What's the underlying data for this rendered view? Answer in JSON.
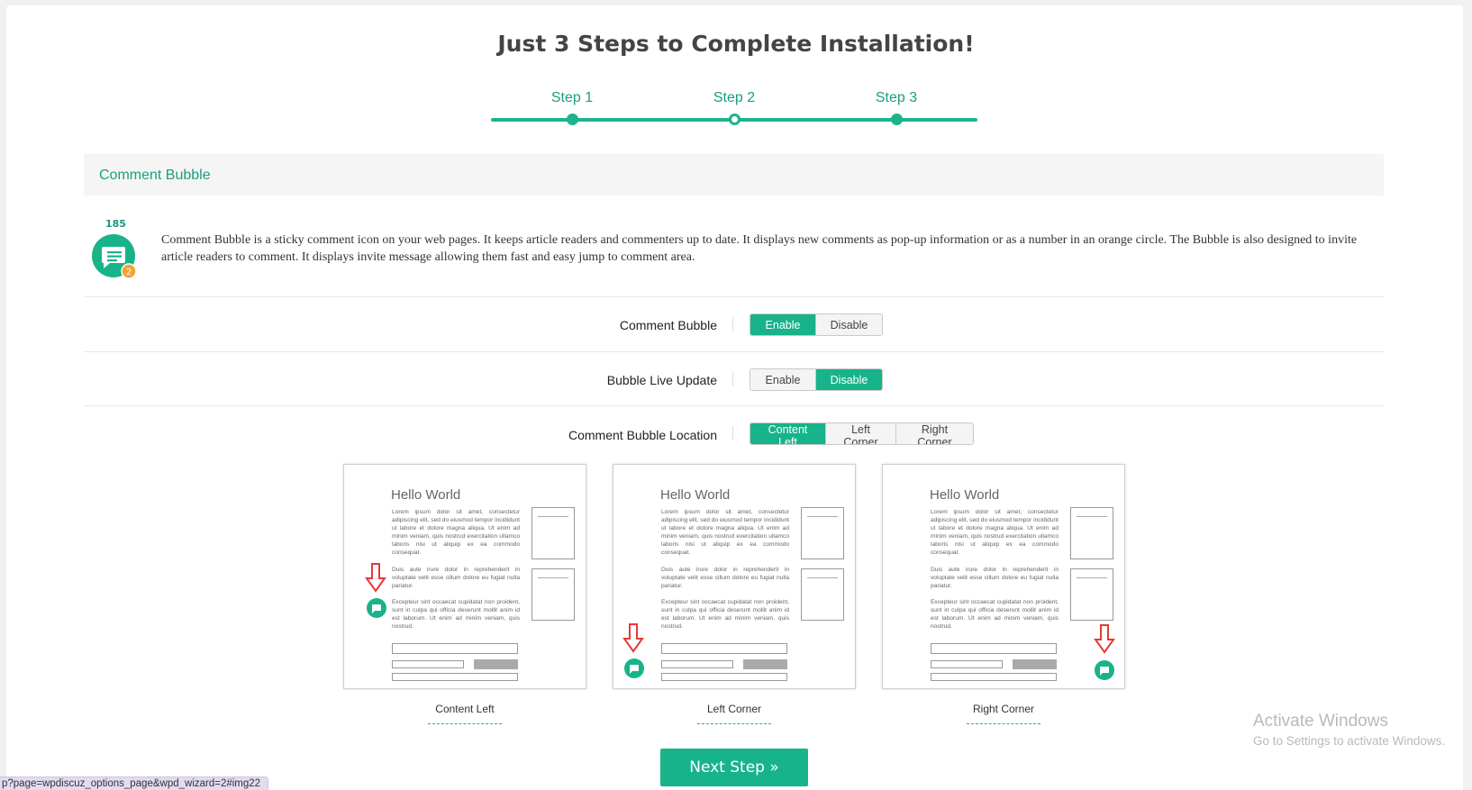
{
  "wizard": {
    "title": "Just 3 Steps to Complete Installation!",
    "steps": [
      {
        "label": "Step 1",
        "state": "done"
      },
      {
        "label": "Step 2",
        "state": "current"
      },
      {
        "label": "Step 3",
        "state": "pending"
      }
    ]
  },
  "section": {
    "heading": "Comment Bubble",
    "bubble_count": "185",
    "bubble_badge": "2",
    "description": "Comment Bubble is a sticky comment icon on your web pages. It keeps article readers and commenters up to date. It displays new comments as pop-up information or as a number in an orange circle. The Bubble is also designed to invite article readers to comment. It displays invite message allowing them fast and easy jump to comment area."
  },
  "options": {
    "comment_bubble": {
      "label": "Comment Bubble",
      "enable": "Enable",
      "disable": "Disable",
      "selected": "Enable"
    },
    "live_update": {
      "label": "Bubble Live Update",
      "enable": "Enable",
      "disable": "Disable",
      "selected": "Disable"
    },
    "location": {
      "label": "Comment Bubble Location",
      "content_left": "Content Left",
      "left_corner": "Left Corner",
      "right_corner": "Right Corner",
      "selected": "Content Left"
    }
  },
  "preview": {
    "title": "Hello World",
    "para1": "Lorem ipsum dolor sit amet, consectetur adipiscing elit, sed do eiusmod tempor incididunt ut labore et dolore magna aliqua. Ut enim ad minim veniam, quis nostrud exercitation ullamco laboris nisi ut aliquip ex ea commodo consequat.",
    "para2": "Duis aute irure dolor in reprehenderit in voluptate velit esse cillum dolore eu fugiat nulla pariatur.",
    "para3": "Excepteur sint occaecat cupidatat non proident, sunt in culpa qui officia deserunt mollit anim id est laborum. Ut enim ad minim veniam, quis nostrud.",
    "captions": {
      "content_left": "Content Left",
      "left_corner": "Left Corner",
      "right_corner": "Right Corner"
    }
  },
  "next_button": "Next Step »",
  "watermark": {
    "title": "Activate Windows",
    "subtitle": "Go to Settings to activate Windows."
  },
  "status_url": "p?page=wpdiscuz_options_page&wpd_wizard=2#img22",
  "colors": {
    "accent": "#17b38a",
    "accent_text": "#1b9d7f",
    "badge": "#f7a130",
    "arrow": "#e53935"
  }
}
